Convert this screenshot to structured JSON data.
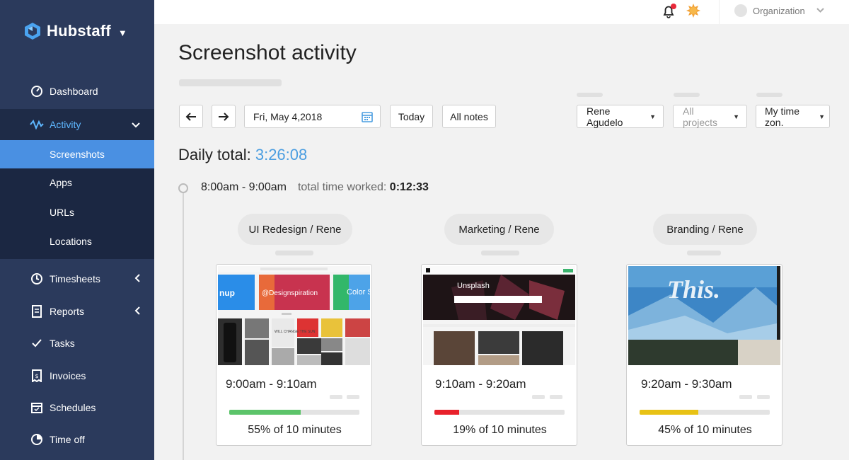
{
  "brand": {
    "name": "Hubstaff"
  },
  "sidebar": {
    "items": [
      {
        "label": "Dashboard",
        "icon": "dashboard-gauge-icon"
      },
      {
        "label": "Activity",
        "icon": "activity-wave-icon",
        "expanded": true
      },
      {
        "label": "Timesheets",
        "icon": "clock-icon"
      },
      {
        "label": "Reports",
        "icon": "report-icon"
      },
      {
        "label": "Tasks",
        "icon": "check-icon"
      },
      {
        "label": "Invoices",
        "icon": "invoice-icon"
      },
      {
        "label": "Schedules",
        "icon": "calendar-check-icon"
      },
      {
        "label": "Time off",
        "icon": "pie-icon"
      }
    ],
    "activity_sub": [
      "Screenshots",
      "Apps",
      "URLs",
      "Locations"
    ],
    "active_sub": "Screenshots"
  },
  "topbar": {
    "org_label": "Organization"
  },
  "page": {
    "title": "Screenshot activity",
    "date": "Fri, May 4,2018",
    "today_label": "Today",
    "all_notes_label": "All notes",
    "user_select": "Rene Agudelo",
    "projects_select": "All projects",
    "timezone_select": "My time zon.",
    "daily_total_label": "Daily total:",
    "daily_total_value": "3:26:08"
  },
  "slot": {
    "range": "8:00am - 9:00am",
    "worked_label": "total time worked:",
    "worked_value": "0:12:33"
  },
  "cards": [
    {
      "project": "UI Redesign / Rene",
      "time": "9:00am - 9:10am",
      "activity": 0.55,
      "activity_label": "55% of 10 minutes",
      "color": "#5cc46a"
    },
    {
      "project": "Marketing / Rene",
      "time": "9:10am - 9:20am",
      "activity": 0.19,
      "activity_label": "19% of 10 minutes",
      "color": "#e8212b"
    },
    {
      "project": "Branding / Rene",
      "time": "9:20am - 9:30am",
      "activity": 0.45,
      "activity_label": "45% of 10 minutes",
      "color": "#e8c215"
    }
  ],
  "thumb_text": {
    "card1_a": "nup",
    "card1_b": "@Designspiration",
    "card1_c": "Color S",
    "card1_mug": "WILL CHANGE THE SUN",
    "card2_title": "Unsplash",
    "card3_word": "This."
  },
  "colors": {
    "sidebar": "#2b3a5c",
    "accent": "#4a90e2",
    "daily_value": "#4a9de0"
  }
}
